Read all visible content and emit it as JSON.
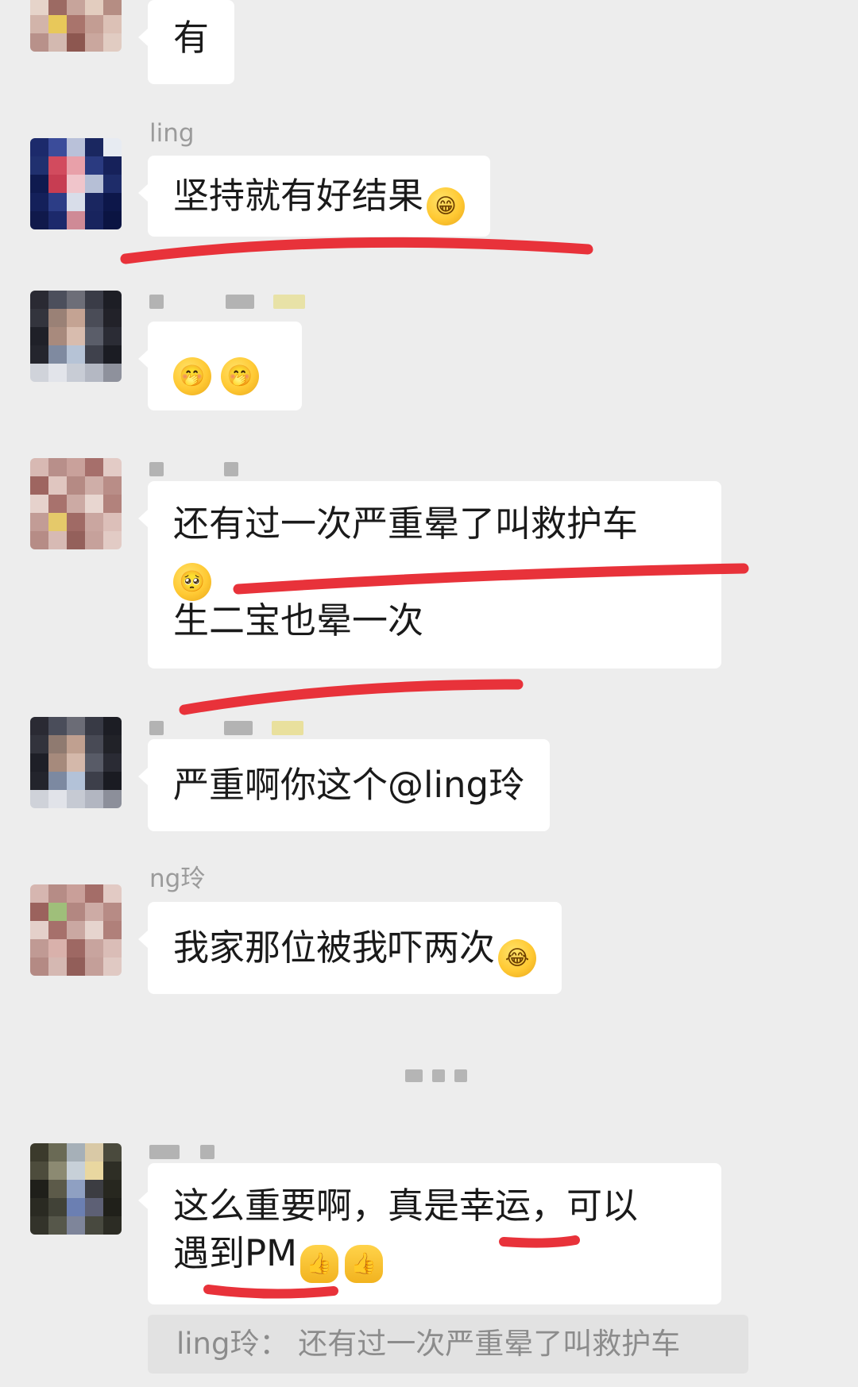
{
  "messages": [
    {
      "sender": "",
      "lines": [
        "有"
      ]
    },
    {
      "sender": "ling",
      "lines": [
        "坚持就有好结果"
      ]
    },
    {
      "sender": "",
      "lines": [
        ""
      ]
    },
    {
      "sender": "",
      "lines": [
        "还有过一次严重晕了叫救护车",
        "",
        "生二宝也晕一次"
      ]
    },
    {
      "sender": "",
      "lines": [
        "严重啊你这个@ling玲"
      ]
    },
    {
      "sender": "ng玲",
      "lines": [
        "我家那位被我吓两次"
      ]
    },
    {
      "sender": "",
      "lines": [
        "这么重要啊，真是幸运，可以",
        "遇到PM"
      ]
    }
  ],
  "quote": {
    "text": "ling玲： 还有过一次严重晕了叫救护车"
  },
  "emoji": {
    "grin": "grinning-face-icon",
    "hand_over_mouth": "hand-over-mouth-icon",
    "pleading": "pleading-face-icon",
    "crying_laughing": "rolling-laughing-icon",
    "thumbs_up": "thumbs-up-icon"
  },
  "colors": {
    "background": "#ededed",
    "bubble": "#ffffff",
    "underline": "#e8323a",
    "name": "#9b9b9b"
  }
}
